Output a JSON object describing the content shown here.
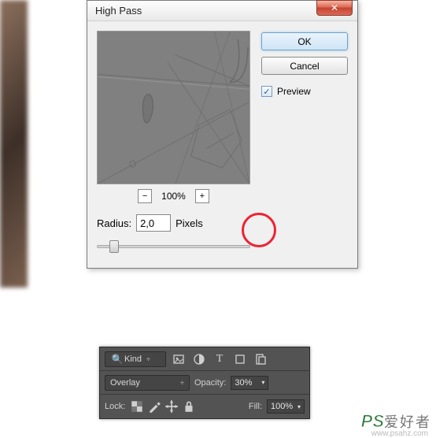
{
  "dialog": {
    "title": "High Pass",
    "ok": "OK",
    "cancel": "Cancel",
    "preview_label": "Preview",
    "preview_checked": "✓",
    "zoom": "100%",
    "minus": "−",
    "plus": "+",
    "radius_label": "Radius:",
    "radius_value": "2,0",
    "radius_unit": "Pixels",
    "close_x": "✕"
  },
  "panel": {
    "kind_label": "Kind",
    "kind_dd": "÷",
    "blend_value": "Overlay",
    "opacity_label": "Opacity:",
    "opacity_value": "30%",
    "lock_label": "Lock:",
    "fill_label": "Fill:",
    "fill_value": "100%"
  },
  "watermark": {
    "ps": "PS",
    "cn": "爱好者",
    "url": "www.psahz.com"
  }
}
